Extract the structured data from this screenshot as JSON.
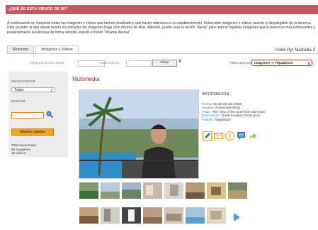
{
  "header": {
    "title": "¿QUÉ SE ESTÁ VIENDO DE MI?"
  },
  "intro": "A continuación se muestran todas las imágenes y vídeos que hemos localizado y que hacen referencia a su establecimiento. Seleccione imágenes o vídeos usando el desplegable de la derecha. Para acceder al sitio donde fueron encontradas las imágenes haga click encima de ellas. Además, puede usar la acción \"Alerta\" para marcar aquellas imágenes que le parezcan más interesantes y posteriormente localizarlas de forma sencilla usando el botón \"Mostrar Alertas\".",
  "tabs": [
    {
      "label": "Resumen",
      "active": false
    },
    {
      "label": "Imágenes y Vídeos",
      "active": true
    }
  ],
  "hotel_name": "Hotel Pyr Marbella 3",
  "filter": {
    "date_from_label": "Filtrar por fechas desde:",
    "date_to_label": "hasta la fecha:",
    "button_label": "Filtrar",
    "clear_label": "X",
    "view_label": "Filtre para ver",
    "view_value": "Imágenes -> Tripadvisor"
  },
  "sidebar": {
    "select_heading": "SELECCIONAR",
    "select_value": "Todas",
    "search_heading": "BUSCAR",
    "alert_button": "Mostrar alertas",
    "total_label": "Total encontrado:",
    "total_images": "50 imagenes",
    "total_videos": "15 videos"
  },
  "multimedia": {
    "title": "Multimedia",
    "info_heading": "INFORMACION",
    "fields": [
      {
        "key": "Fecha:",
        "value": "01 del 06 del 2005"
      },
      {
        "key": "Usuario:",
        "value": "AmericaninSicily"
      },
      {
        "key": "Título:",
        "value": "The view of the pool from our room"
      },
      {
        "key": "Descripción:",
        "value": "Great location Great price"
      },
      {
        "key": "Fuente:",
        "value": "Tripadvisor"
      }
    ]
  },
  "icons": [
    "edit-icon",
    "email-icon",
    "alert-icon",
    "comment-icon",
    "share-icon",
    "search-icon",
    "play-next-icon"
  ],
  "colors": {
    "header_red": "#c45a5f",
    "accent_red": "#b4272d",
    "alert_orange": "#f6a623",
    "link_blue": "#2a7fc0"
  }
}
